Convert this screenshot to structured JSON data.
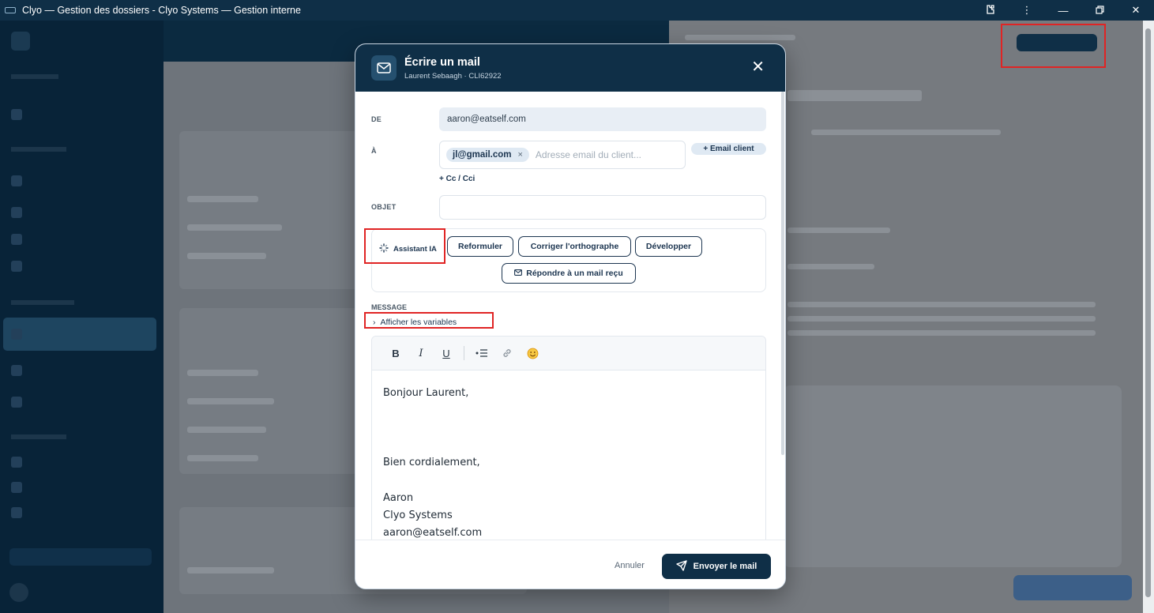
{
  "window": {
    "title": "Clyo — Gestion des dossiers - Clyo Systems — Gestion interne",
    "controls": [
      "extensions",
      "more",
      "minimize",
      "restore",
      "close"
    ]
  },
  "modal": {
    "title": "Écrire un mail",
    "subtitle": "Laurent Sebaagh · CLI62922",
    "from_label": "DE",
    "from_value": "aaron@eatself.com",
    "to_label": "À",
    "to_chip": "jl@gmail.com",
    "to_chip_remove": "×",
    "to_placeholder": "Adresse email du client...",
    "email_client_button": "+ Email client",
    "cc_link": "+ Cc / Cci",
    "subject_label": "OBJET",
    "subject_value": "",
    "ai": {
      "label": "Assistant IA",
      "actions": [
        "Reformuler",
        "Corriger l'orthographe",
        "Développer",
        "Répondre à un mail reçu"
      ]
    },
    "message_label": "MESSAGE",
    "variables_link": "Afficher les variables",
    "toolbar": {
      "bold": "B",
      "italic": "I",
      "underline": "U"
    },
    "body_lines": [
      "Bonjour Laurent,",
      "",
      "",
      "",
      "Bien cordialement,",
      "",
      "Aaron",
      "Clyo Systems",
      "aaron@eatself.com"
    ],
    "cancel": "Annuler",
    "send": "Envoyer le mail"
  },
  "colors": {
    "primary_dark": "#0f2f47",
    "annotation_red": "#e02424",
    "chip_bg": "#dfe9f3"
  }
}
